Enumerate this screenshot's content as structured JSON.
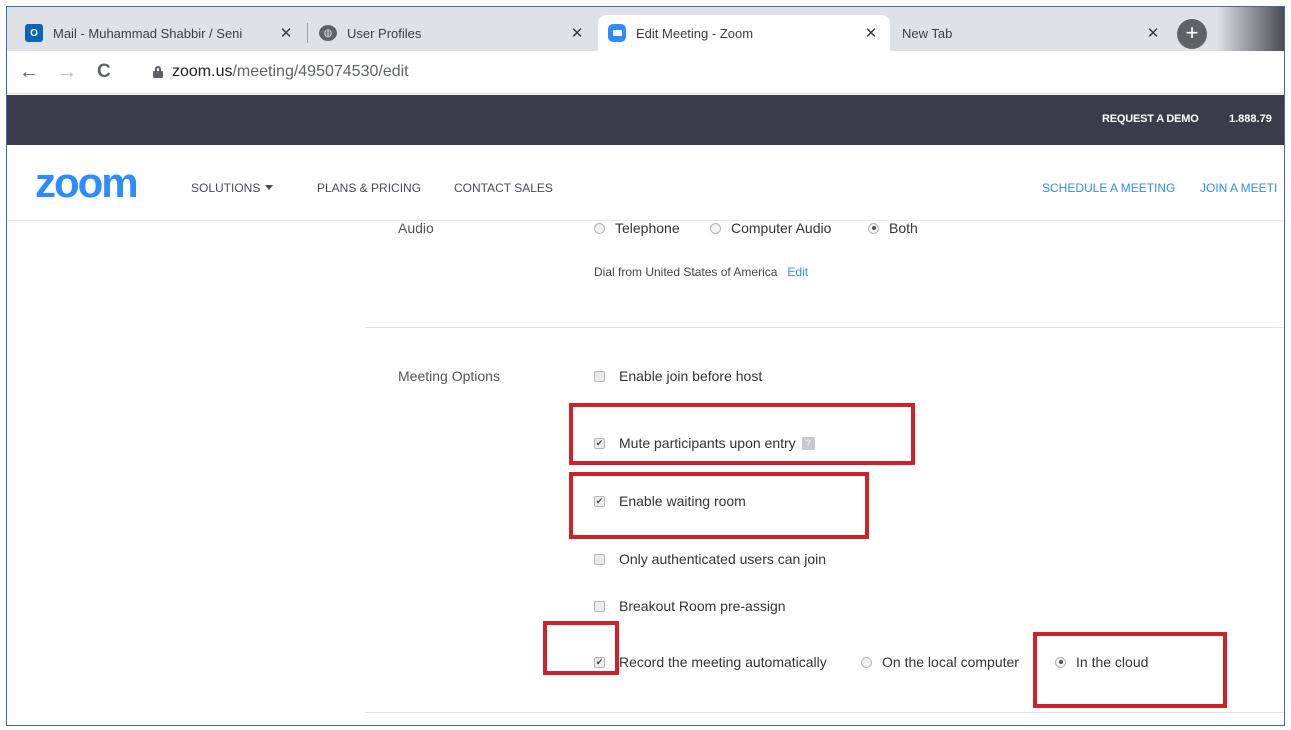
{
  "browser": {
    "tabs": [
      {
        "title": "Mail - Muhammad Shabbir / Seni",
        "icon": "outlook-icon",
        "close": "✕"
      },
      {
        "title": "User Profiles",
        "icon": "globe-icon",
        "close": "✕"
      },
      {
        "title": "Edit Meeting - Zoom",
        "icon": "zoom-icon",
        "close": "✕"
      },
      {
        "title": "New Tab",
        "close": "✕"
      }
    ],
    "new_tab_label": "+",
    "url_host": "zoom.us",
    "url_path": "/meeting/495074530/edit",
    "back_glyph": "←",
    "forward_glyph": "→",
    "reload_glyph": "C"
  },
  "topbar": {
    "request_demo": "REQUEST A DEMO",
    "phone": "1.888.79"
  },
  "nav": {
    "logo": "zoom",
    "solutions": "SOLUTIONS",
    "plans": "PLANS & PRICING",
    "contact": "CONTACT SALES",
    "schedule": "SCHEDULE A MEETING",
    "join": "JOIN A MEETI"
  },
  "audio": {
    "label": "Audio",
    "options": [
      "Telephone",
      "Computer Audio",
      "Both"
    ],
    "selected": "Both",
    "dial_from": "Dial from United States of America",
    "edit_link": "Edit"
  },
  "meeting_options": {
    "label": "Meeting Options",
    "items": [
      {
        "label": "Enable join before host",
        "checked": false
      },
      {
        "label": "Mute participants upon entry",
        "checked": true
      },
      {
        "label": "Enable waiting room",
        "checked": true
      },
      {
        "label": "Only authenticated users can join",
        "checked": false
      },
      {
        "label": "Breakout Room pre-assign",
        "checked": false
      },
      {
        "label": "Record the meeting automatically",
        "checked": true
      }
    ],
    "record_targets": [
      "On the local computer",
      "In the cloud"
    ],
    "record_selected": "In the cloud",
    "check_glyph": "✔"
  },
  "colors": {
    "zoom_blue": "#2d8cff",
    "topbar": "#3a3c4a",
    "highlight": "#d0202a"
  }
}
